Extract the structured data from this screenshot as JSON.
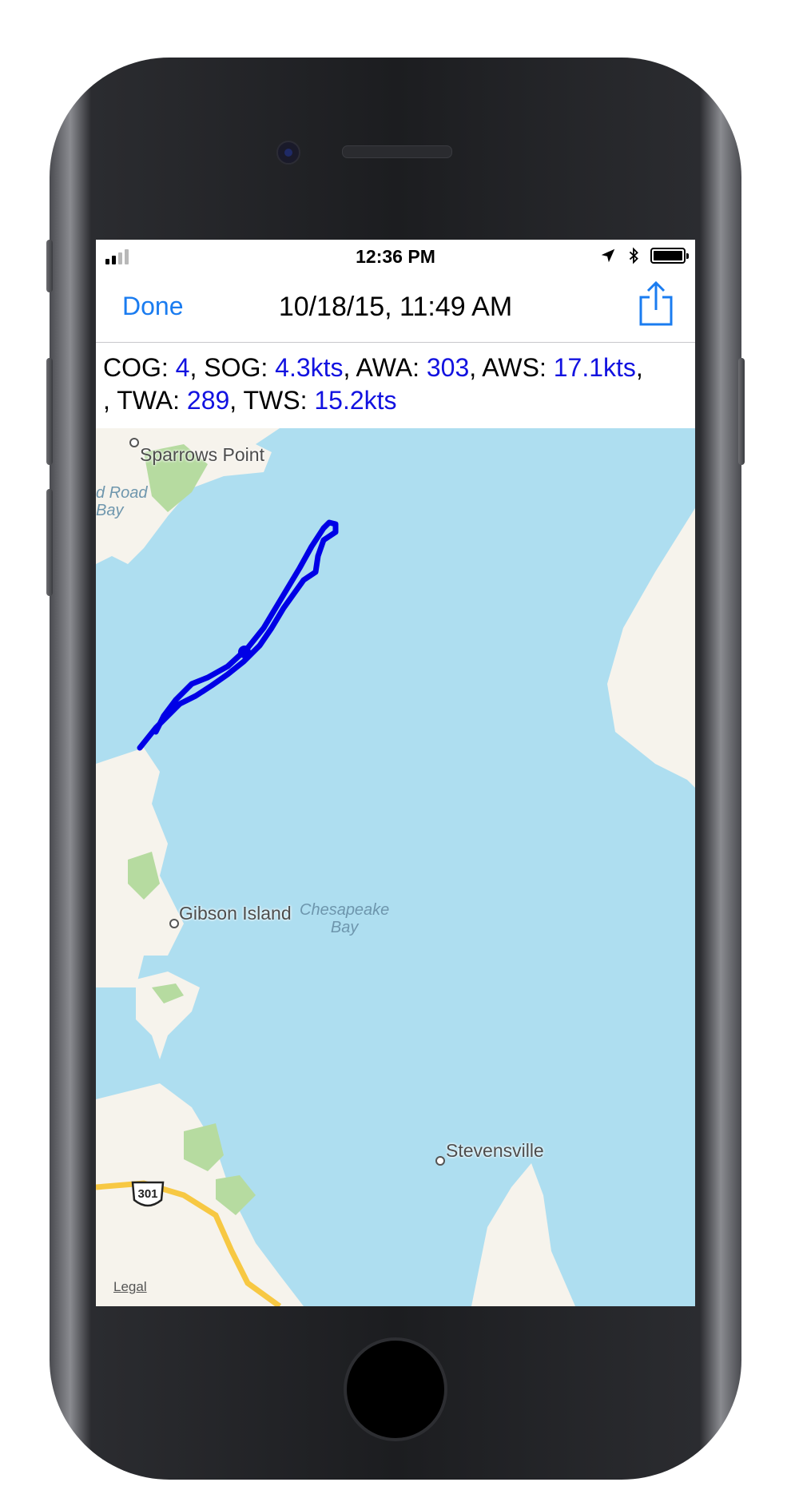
{
  "status_bar": {
    "time": "12:36 PM",
    "signal_bars_active": 2,
    "signal_bars_total": 4,
    "location_icon": "location-arrow-icon",
    "bluetooth_icon": "bluetooth-icon",
    "battery_level": 1.0
  },
  "nav": {
    "done_label": "Done",
    "title": "10/18/15, 11:49 AM",
    "share_icon": "share-icon"
  },
  "info": {
    "cog_label": "COG: ",
    "cog_value": "4",
    "sog_label": ", SOG: ",
    "sog_value": "4.3kts",
    "awa_label": ", AWA: ",
    "awa_value": "303",
    "aws_label": ", AWS: ",
    "aws_value": "17.1kts",
    "twa_label": ", TWA: ",
    "twa_value": "289",
    "tws_label": ", TWS: ",
    "tws_value": "15.2kts",
    "value_color": "#1212e0"
  },
  "map": {
    "labels": {
      "sparrows_point": "Sparrows Point",
      "road_bay_1": "d Road",
      "road_bay_2": "Bay",
      "gibson_island": "Gibson Island",
      "chesapeake_1": "Chesapeake",
      "chesapeake_2": "Bay",
      "stevensville": "Stevensville",
      "route_301": "301"
    },
    "legal_label": "Legal",
    "track_color": "#0000e6",
    "water_color": "#aedef0",
    "land_color": "#f6f3ec",
    "park_color": "#b6dba0",
    "road_color": "#f7c843"
  }
}
